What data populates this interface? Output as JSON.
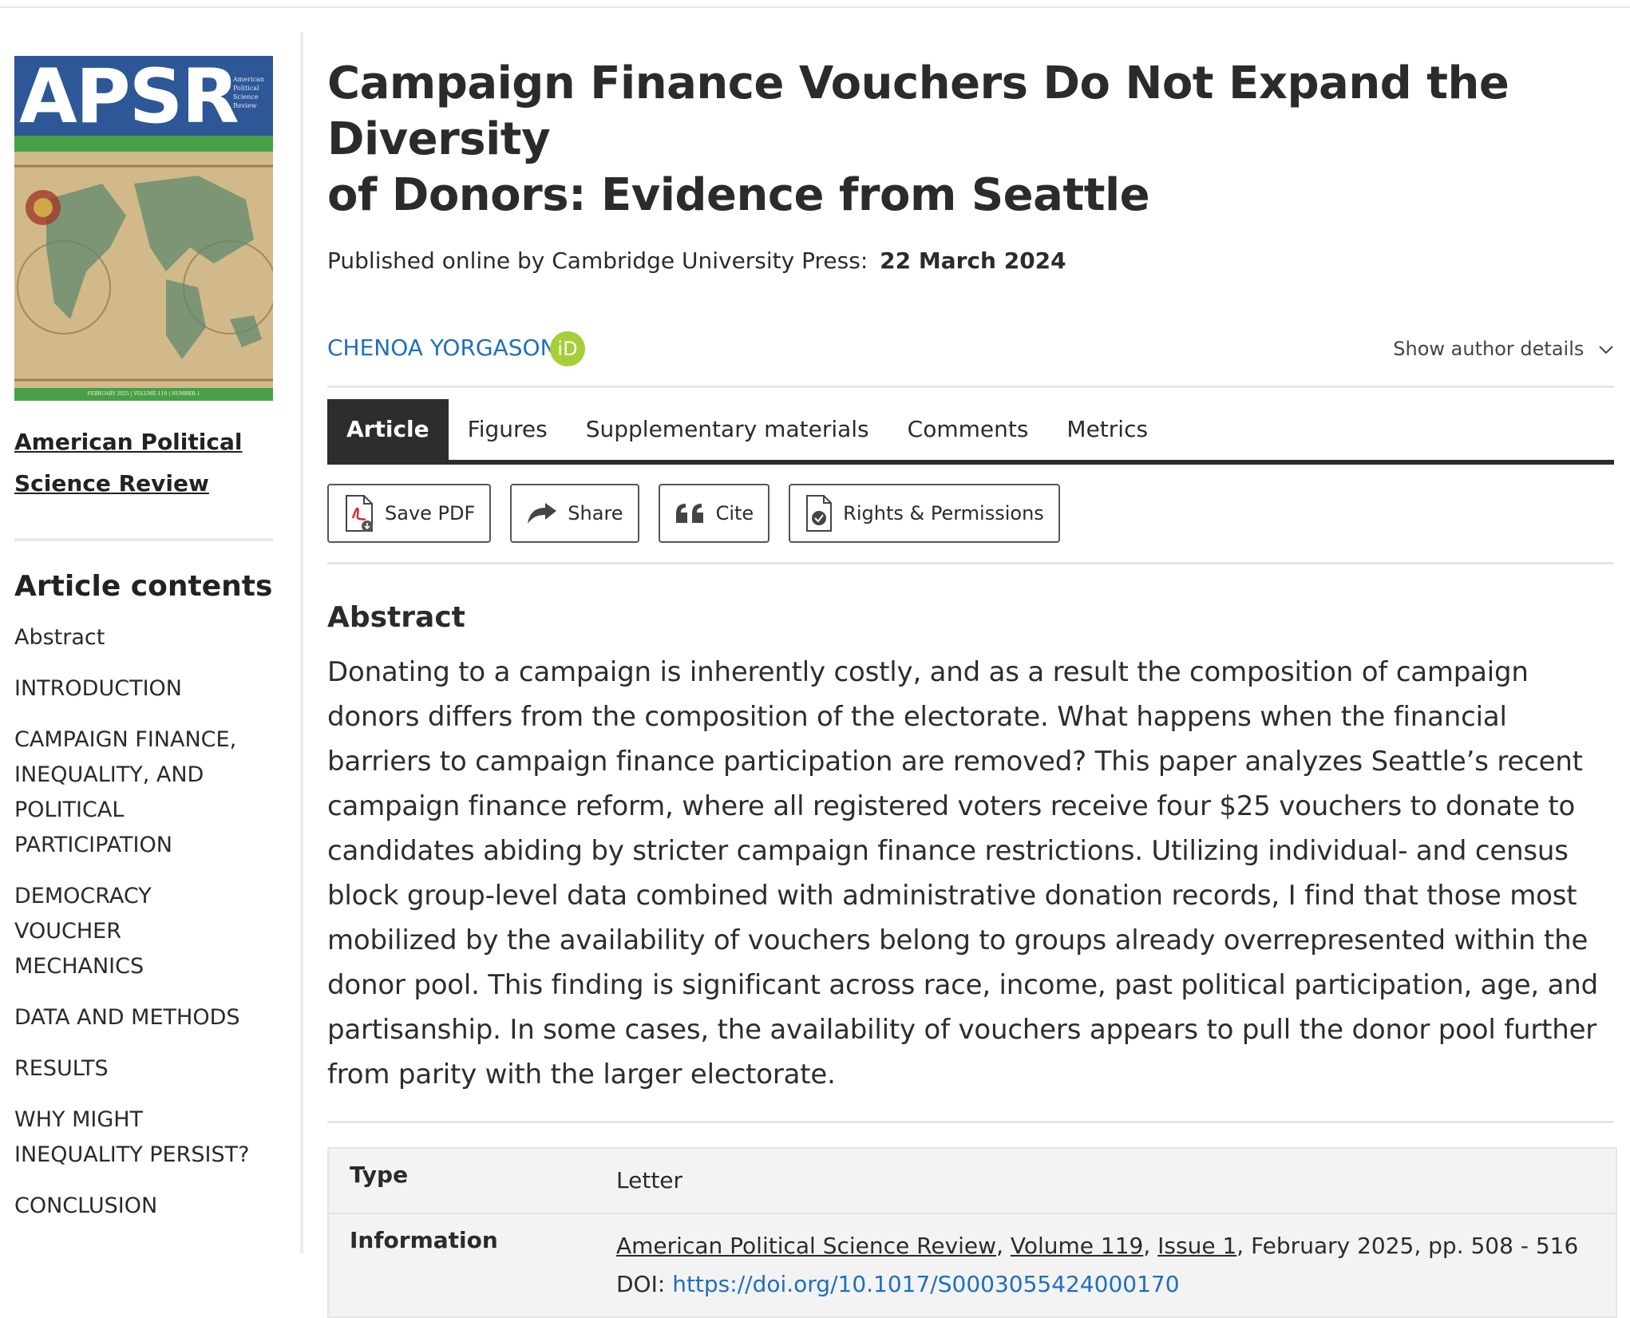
{
  "sidebar": {
    "cover": {
      "logo": "APSR",
      "small_text": "American Political Science Review",
      "footer": "FEBRUARY 2025 | VOLUME 119 | NUMBER 1",
      "colors": {
        "top": "#2d5797",
        "band": "#47a046"
      }
    },
    "journal_line1": "American Political",
    "journal_line2": "Science Review",
    "contents_title": "Article contents",
    "toc": [
      "Abstract",
      "INTRODUCTION",
      "CAMPAIGN FINANCE,",
      "INEQUALITY, AND",
      "POLITICAL",
      "PARTICIPATION",
      "DEMOCRACY",
      "VOUCHER",
      "MECHANICS",
      "DATA AND METHODS",
      "RESULTS",
      "WHY MIGHT",
      "INEQUALITY PERSIST?",
      "CONCLUSION"
    ]
  },
  "article": {
    "title_line1": "Campaign Finance Vouchers Do Not Expand the Diversity",
    "title_line2": "of Donors: Evidence from Seattle",
    "published_prefix": "Published online by Cambridge University Press:",
    "published_date": "22 March 2024",
    "author": "CHENOA YORGASON",
    "orcid_label": "iD",
    "author_details": "Show author details",
    "tabs": [
      "Article",
      "Figures",
      "Supplementary materials",
      "Comments",
      "Metrics"
    ],
    "actions": {
      "save_pdf": "Save PDF",
      "share": "Share",
      "cite": "Cite",
      "rights": "Rights & Permissions"
    },
    "abstract_heading": "Abstract",
    "abstract_lines": [
      "Donating to a campaign is inherently costly, and as a result the composition of campaign",
      "donors differs from the composition of the electorate. What happens when the financial",
      "barriers to campaign finance participation are removed? This paper analyzes Seattle’s recent",
      "campaign finance reform, where all registered voters receive four $25 vouchers to donate to",
      "candidates abiding by stricter campaign finance restrictions. Utilizing individual- and census",
      "block group-level data combined with administrative donation records, I find that those most",
      "mobilized by the availability of vouchers belong to groups already overrepresented within the",
      "donor pool. This finding is significant across race, income, past political participation, age, and",
      "partisanship. In some cases, the availability of vouchers appears to pull the donor pool further",
      "from parity with the larger electorate."
    ],
    "meta": {
      "type_label": "Type",
      "type_value": "Letter",
      "info_label": "Information",
      "journal": "American Political Science Review",
      "volume": "Volume 119",
      "issue": "Issue 1",
      "date_pages": "February 2025, pp. 508 - 516",
      "doi_label": "DOI:",
      "doi": "https://doi.org/10.1017/S0003055424000170"
    },
    "colors": {
      "link": "#1f6fbf",
      "tab_active": "#2d2d2d",
      "orcid": "#a6ce39"
    }
  }
}
